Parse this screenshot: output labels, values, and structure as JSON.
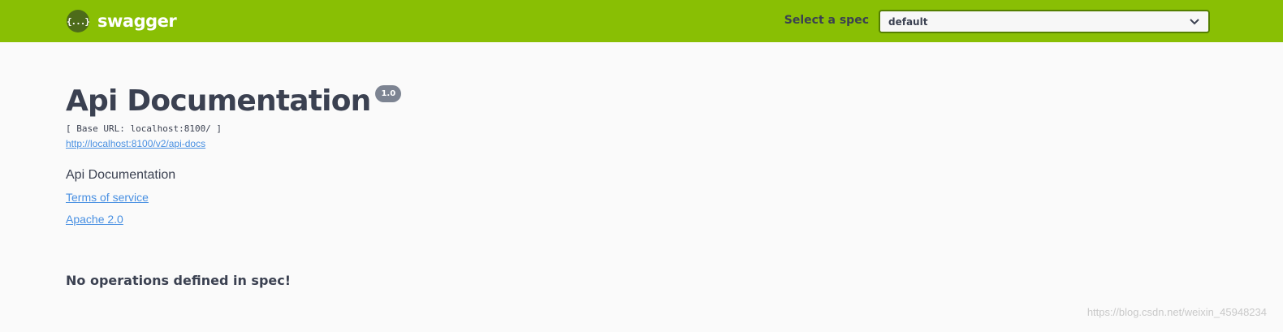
{
  "topbar": {
    "brand_icon_text": "{...}",
    "brand_name": "swagger",
    "spec_label": "Select a spec",
    "spec_selected": "default",
    "colors": {
      "bar": "#89bf04",
      "select_border": "#547f00"
    }
  },
  "info": {
    "title": "Api Documentation",
    "version": "1.0",
    "base_url": "[ Base URL: localhost:8100/ ]",
    "api_docs_link": "http://localhost:8100/v2/api-docs",
    "description": "Api Documentation",
    "terms_link": "Terms of service",
    "license_link": "Apache 2.0"
  },
  "operations": {
    "empty_message": "No operations defined in spec!"
  },
  "watermark": "https://blog.csdn.net/weixin_45948234"
}
